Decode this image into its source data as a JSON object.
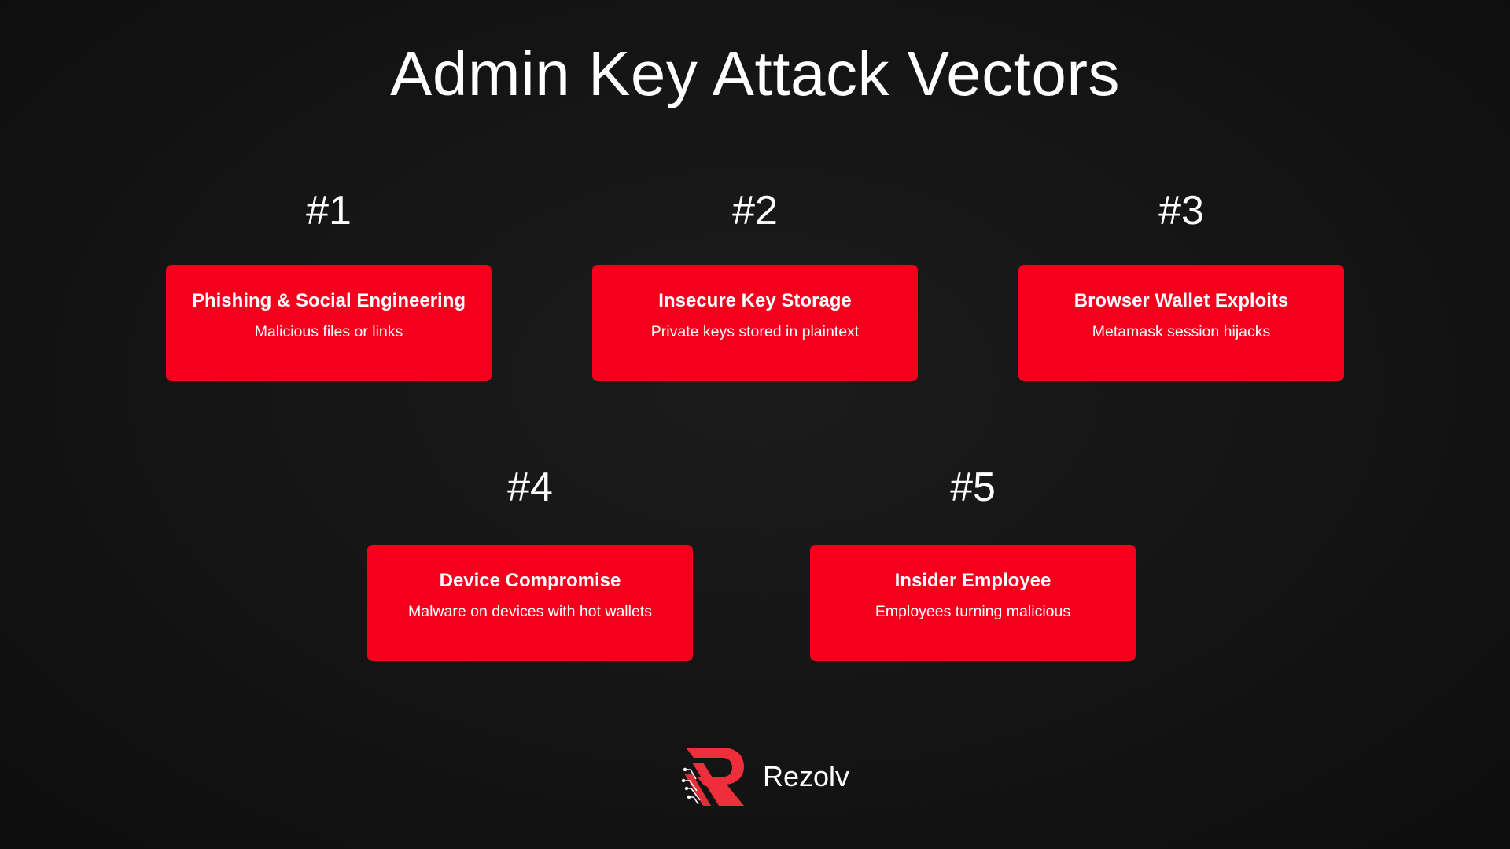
{
  "title": "Admin Key Attack Vectors",
  "vectors": [
    {
      "number": "#1",
      "title": "Phishing & Social Engineering",
      "description": "Malicious files or links"
    },
    {
      "number": "#2",
      "title": "Insecure Key Storage",
      "description": "Private keys stored in plaintext"
    },
    {
      "number": "#3",
      "title": "Browser Wallet Exploits",
      "description": "Metamask session hijacks"
    },
    {
      "number": "#4",
      "title": "Device Compromise",
      "description": "Malware on devices with hot wallets"
    },
    {
      "number": "#5",
      "title": "Insider Employee",
      "description": "Employees turning malicious"
    }
  ],
  "brand": {
    "name": "Rezolv",
    "logo_icon": "rezolv-r-logo-icon",
    "accent_color": "#f5001c"
  }
}
